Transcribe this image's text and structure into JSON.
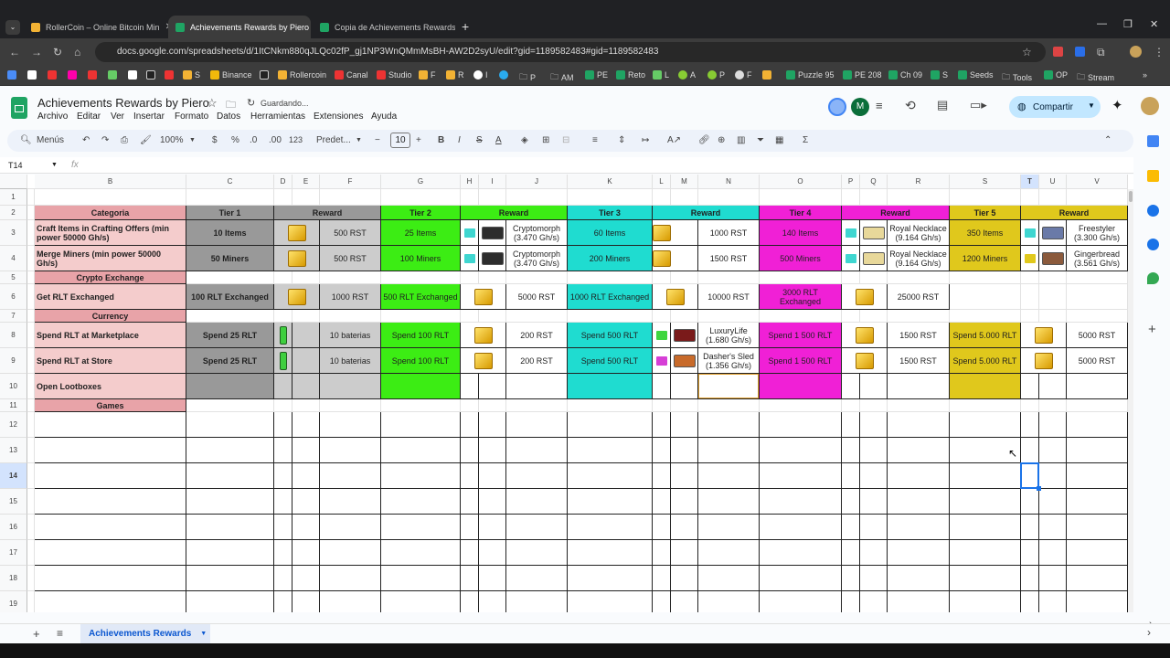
{
  "browser": {
    "tabs": [
      {
        "title": "RollerCoin – Online Bitcoin Min",
        "color": "#f2b234"
      },
      {
        "title": "Achievements Rewards by Piero",
        "color": "#1fa463"
      },
      {
        "title": "Copia de Achievements Rewards",
        "color": "#1fa463"
      }
    ],
    "url": "docs.google.com/spreadsheets/d/1ItCNkm880qJLQc02fP_gj1NP3WnQMmMsBH-AW2D2syU/edit?gid=1189582483#gid=1189582483",
    "bookmarks": [
      "S",
      "Binance",
      "Rollercoin",
      "Canal",
      "Studio",
      "F",
      "R",
      "I",
      "P",
      "AM",
      "PE",
      "Reto",
      "L",
      "A",
      "P",
      "F",
      "Puzzle 95",
      "PE 208",
      "Ch 09",
      "S",
      "Seeds",
      "Tools",
      "OP",
      "Stream"
    ]
  },
  "doc": {
    "title": "Achievements Rewards by Piero",
    "status": "Guardando...",
    "menus": [
      "Archivo",
      "Editar",
      "Ver",
      "Insertar",
      "Formato",
      "Datos",
      "Herramientas",
      "Extensiones",
      "Ayuda"
    ],
    "share_label": "Compartir",
    "avatar_letter": "M"
  },
  "toolbar": {
    "search": "Menús",
    "zoom": "100%",
    "currency": "$",
    "percent": "%",
    "dec_less": ".0",
    "dec_more": ".00",
    "num_format": "123",
    "font": "Predet...",
    "font_size": "10"
  },
  "formula_bar": {
    "cell_ref": "T14",
    "fx": "fx"
  },
  "columns": [
    "B",
    "C",
    "D",
    "E",
    "F",
    "G",
    "H",
    "I",
    "J",
    "K",
    "L",
    "M",
    "N",
    "O",
    "P",
    "Q",
    "R",
    "S",
    "T",
    "U",
    "V"
  ],
  "rows": [
    "1",
    "2",
    "3",
    "4",
    "5",
    "6",
    "7",
    "8",
    "9",
    "10",
    "11",
    "12",
    "13",
    "14",
    "15",
    "16",
    "17",
    "18",
    "19"
  ],
  "table": {
    "header": {
      "categoria": "Categoria",
      "tier1": "Tier 1",
      "reward1": "Reward",
      "tier2": "Tier 2",
      "reward2": "Reward",
      "tier3": "Tier 3",
      "reward3": "Reward",
      "tier4": "Tier 4",
      "reward4": "Reward",
      "tier5": "Tier 5",
      "reward5": "Reward"
    },
    "r3": {
      "cat": "Craft Items in Crafting Offers (min power 50000 Gh/s)",
      "t1": "10 Items",
      "r1": "500 RST",
      "t2": "25 Items",
      "r2": "Cryptomorph (3.470 Gh/s)",
      "t3": "60 Items",
      "r3": "1000 RST",
      "t4": "140 Items",
      "r4": "Royal Necklace (9.164 Gh/s)",
      "t5": "350 Items",
      "r5": "Freestyler (3.300 Gh/s)"
    },
    "r4": {
      "cat": "Merge Miners (min power 50000 Gh/s)",
      "t1": "50 Miners",
      "r1": "500 RST",
      "t2": "100 Miners",
      "r2": "Cryptomorph (3.470 Gh/s)",
      "t3": "200 Miners",
      "r3": "1500 RST",
      "t4": "500 Miners",
      "r4": "Royal Necklace (9.164 Gh/s)",
      "t5": "1200 Miners",
      "r5": "Gingerbread (3.561 Gh/s)"
    },
    "r5": {
      "cat": "Crypto Exchange"
    },
    "r6": {
      "cat": "Get RLT Exchanged",
      "t1": "100 RLT Exchanged",
      "r1": "1000 RST",
      "t2": "500 RLT Exchanged",
      "r2": "5000 RST",
      "t3": "1000 RLT Exchanged",
      "r3": "10000 RST",
      "t4": "3000 RLT Exchanged",
      "r4": "25000 RST"
    },
    "r7": {
      "cat": "Currency"
    },
    "r8": {
      "cat": "Spend RLT at Marketplace",
      "t1": "Spend 25 RLT",
      "r1": "10 baterias",
      "t2": "Spend 100 RLT",
      "r2": "200 RST",
      "t3": "Spend 500 RLT",
      "r3": "LuxuryLife (1.680 Gh/s)",
      "t4": "Spend 1 500 RLT",
      "r4": "1500 RST",
      "t5": "Spend 5.000 RLT",
      "r5": "5000 RST"
    },
    "r9": {
      "cat": "Spend RLT at Store",
      "t1": "Spend 25 RLT",
      "r1": "10 baterias",
      "t2": "Spend 100 RLT",
      "r2": "200 RST",
      "t3": "Spend 500 RLT",
      "r3": "Dasher's Sled (1.356 Gh/s)",
      "t4": "Spend 1 500 RLT",
      "r4": "1500 RST",
      "t5": "Spend 5.000 RLT",
      "r5": "5000 RST"
    },
    "r10": {
      "cat": "Open Lootboxes"
    },
    "r11": {
      "cat": "Games"
    }
  },
  "sheet_tab": "Achievements Rewards",
  "colors": {
    "category": "#e8a3a8",
    "category_light": "#f4cccc",
    "tier1": "#999999",
    "tier1_light": "#cccccc",
    "tier2": "#3ced14",
    "tier3": "#1fdcd0",
    "tier4": "#f020d6",
    "tier5": "#e0c81c",
    "tier5_light": "#fff2cc"
  }
}
